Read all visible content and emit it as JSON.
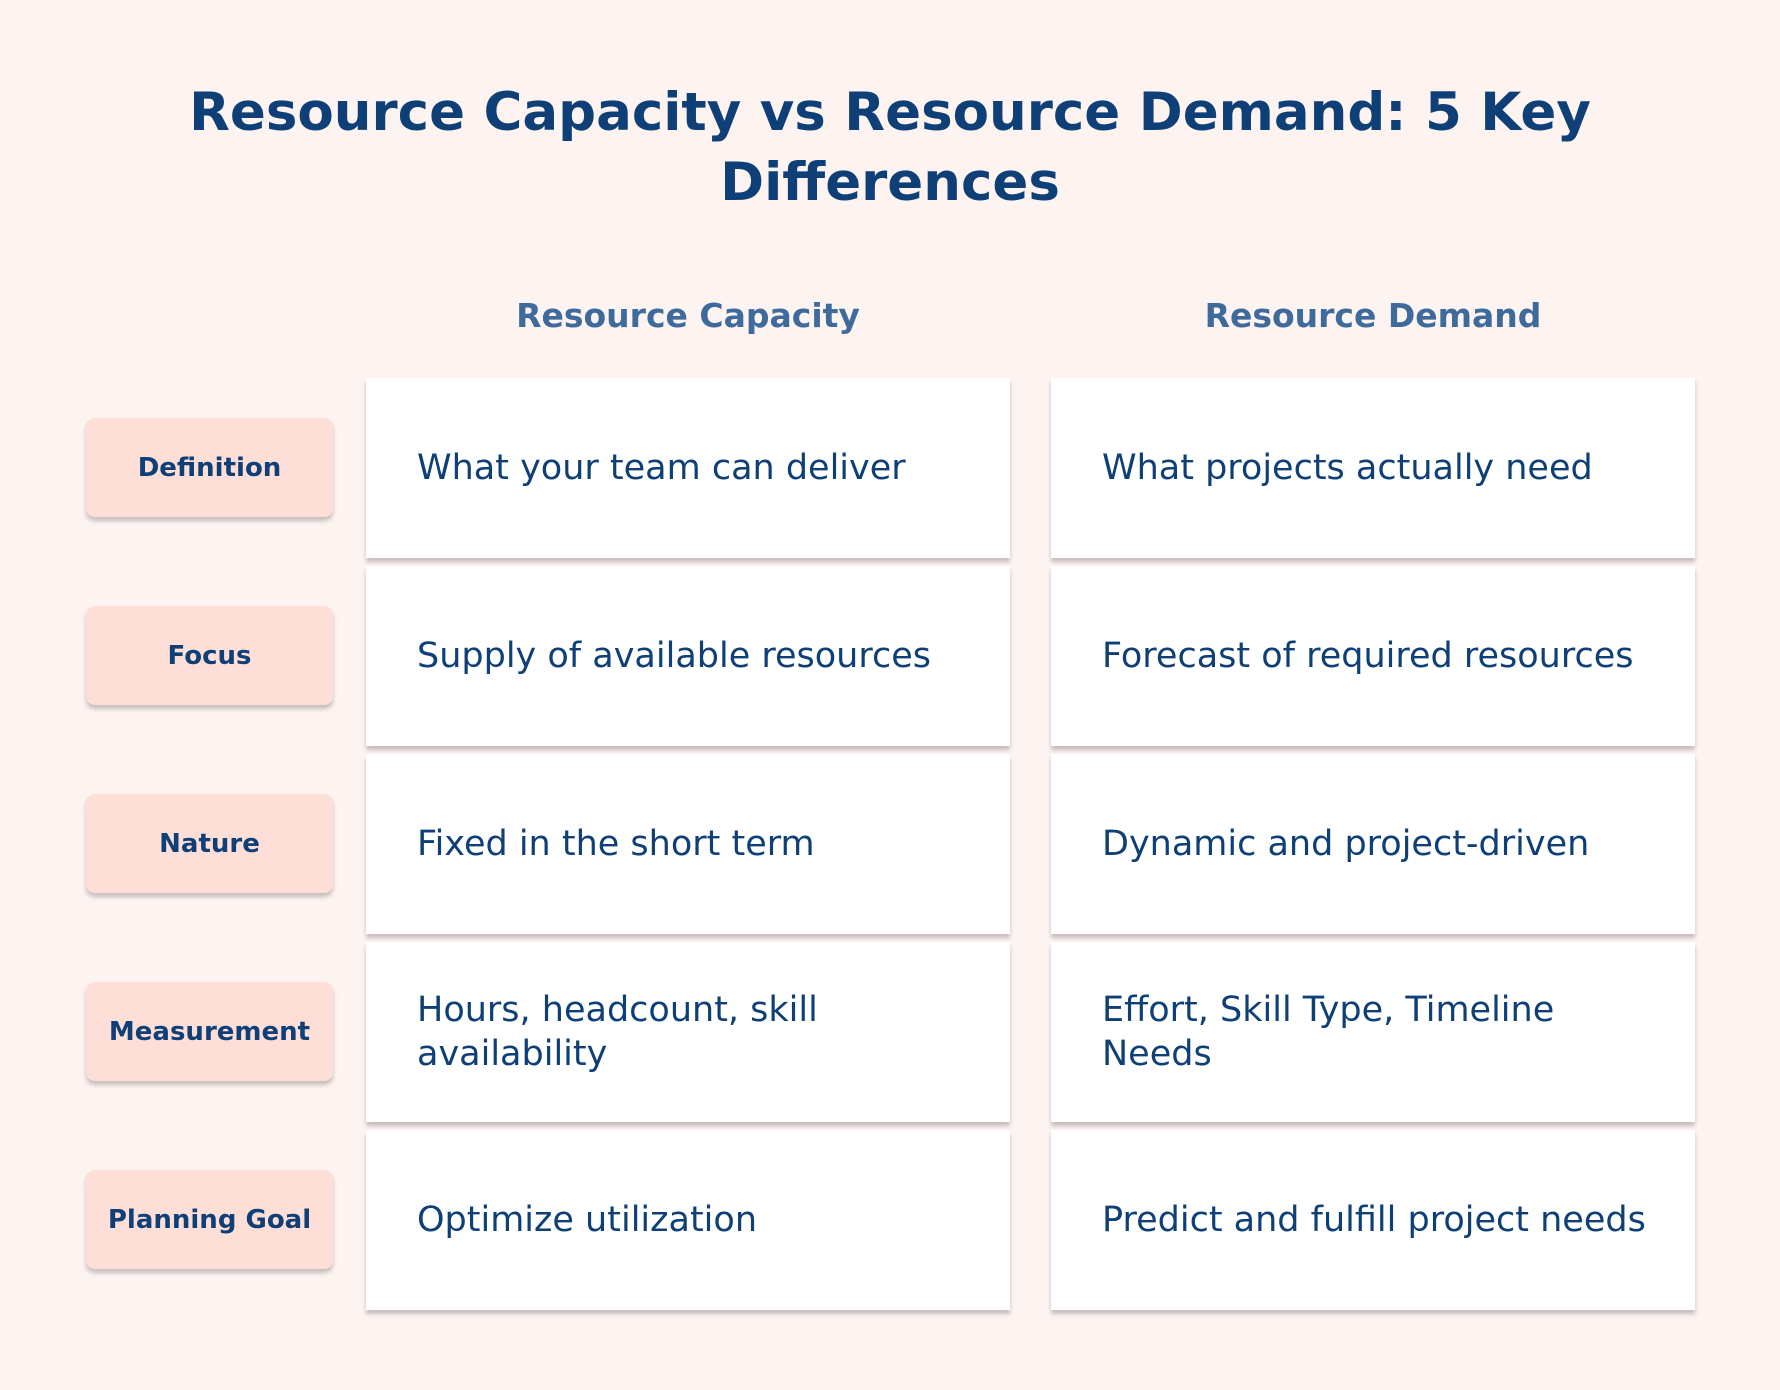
{
  "title": "Resource Capacity vs Resource Demand: 5 Key Differences",
  "columns": {
    "capacity": "Resource Capacity",
    "demand": "Resource Demand"
  },
  "rows": [
    {
      "label": "Definition",
      "capacity": "What your team can deliver",
      "demand": "What projects actually need"
    },
    {
      "label": "Focus",
      "capacity": "Supply of available resources",
      "demand": "Forecast of required resources"
    },
    {
      "label": "Nature",
      "capacity": "Fixed in the short term",
      "demand": "Dynamic and project-driven"
    },
    {
      "label": "Measurement",
      "capacity": "Hours, headcount, skill availability",
      "demand": "Effort, Skill Type, Timeline Needs"
    },
    {
      "label": "Planning Goal",
      "capacity": "Optimize utilization",
      "demand": "Predict and fulfill project needs"
    }
  ]
}
